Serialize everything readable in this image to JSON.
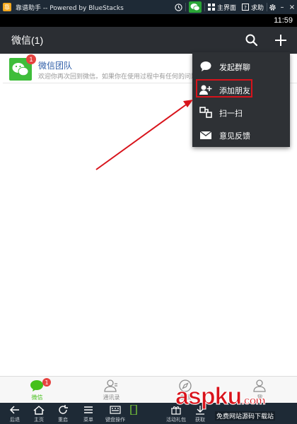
{
  "emulator": {
    "title": "靠谱助手 -- Powered by BlueStacks",
    "home_label": "主界面",
    "help_label": "求助",
    "bottom_buttons": [
      {
        "label": "后退",
        "icon": "back-arrow-icon"
      },
      {
        "label": "主页",
        "icon": "home-icon"
      },
      {
        "label": "重启",
        "icon": "rotate-icon"
      },
      {
        "label": "菜单",
        "icon": "menu-icon"
      },
      {
        "label": "键盘操作",
        "icon": "keyboard-icon"
      },
      {
        "label": "活动礼包",
        "icon": "gift-icon"
      },
      {
        "label": "获取",
        "icon": "download-icon"
      }
    ]
  },
  "status_bar": {
    "time": "11:59"
  },
  "header": {
    "title": "微信(1)"
  },
  "chats": [
    {
      "name": "微信团队",
      "preview": "欢迎你再次回到微信。如果你在使用过程中有任何的问题",
      "unread": "1"
    }
  ],
  "menu": {
    "items": [
      {
        "label": "发起群聊",
        "icon": "chat-bubble-icon"
      },
      {
        "label": "添加朋友",
        "icon": "add-friend-icon"
      },
      {
        "label": "扫一扫",
        "icon": "scan-icon"
      },
      {
        "label": "意见反馈",
        "icon": "mail-icon"
      }
    ]
  },
  "tabs": [
    {
      "label": "微信",
      "badge": "1"
    },
    {
      "label": "通讯录"
    },
    {
      "label": "发现"
    },
    {
      "label": "我"
    }
  ],
  "watermark": {
    "main": "aspku",
    "sub": "免费网站源码下载站",
    "suffix": ".com"
  },
  "colors": {
    "accent": "#45c01a",
    "highlight": "#d8131b",
    "header_bg": "#2b2e33",
    "menu_bg": "#2e3135"
  }
}
